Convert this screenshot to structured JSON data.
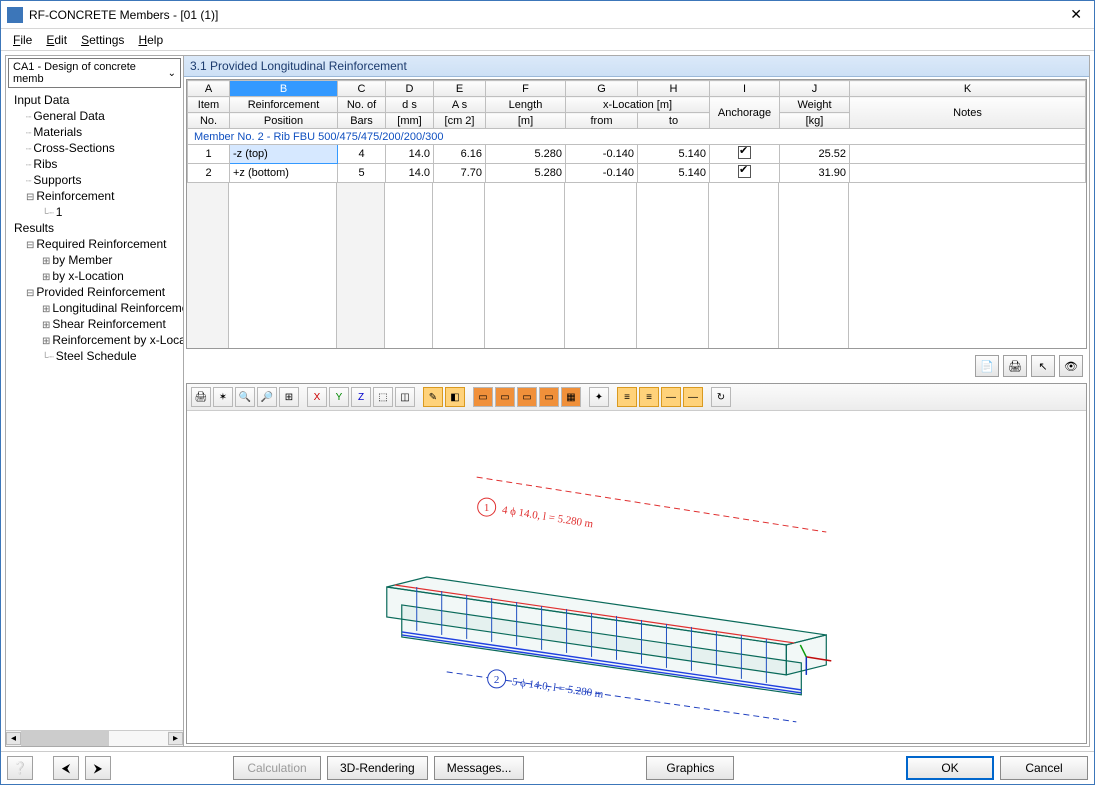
{
  "window": {
    "title": "RF-CONCRETE Members - [01 (1)]"
  },
  "menu": {
    "file": "File",
    "edit": "Edit",
    "settings": "Settings",
    "help": "Help"
  },
  "case_dropdown": "CA1 - Design of concrete memb",
  "tree": {
    "section_input": "Input Data",
    "general_data": "General Data",
    "materials": "Materials",
    "cross_sections": "Cross-Sections",
    "ribs": "Ribs",
    "supports": "Supports",
    "reinforcement": "Reinforcement",
    "reinf_1": "1",
    "section_results": "Results",
    "required": "Required Reinforcement",
    "by_member": "by Member",
    "by_x": "by x-Location",
    "provided": "Provided Reinforcement",
    "long_reinf": "Longitudinal Reinforcement",
    "shear_reinf": "Shear Reinforcement",
    "reinf_by_x": "Reinforcement by x-Location",
    "steel_sched": "Steel Schedule"
  },
  "panel_title": "3.1 Provided Longitudinal Reinforcement",
  "columns": {
    "letters": [
      "A",
      "B",
      "C",
      "D",
      "E",
      "F",
      "G",
      "H",
      "I",
      "J",
      "K"
    ],
    "h": {
      "item": "Item",
      "reinforcement": "Reinforcement",
      "no_of": "No. of",
      "ds": "d s",
      "as": "A s",
      "length": "Length",
      "xloc": "x-Location [m]",
      "anchorage": "Anchorage",
      "weight": "Weight",
      "notes": "Notes",
      "no": "No.",
      "position": "Position",
      "bars": "Bars",
      "mm": "[mm]",
      "cm2": "[cm 2]",
      "m": "[m]",
      "from": "from",
      "to": "to",
      "kg": "[kg]"
    }
  },
  "member_row": "Member No. 2  -  Rib FBU 500/475/475/200/200/300",
  "rows": [
    {
      "item": "1",
      "pos": "-z (top)",
      "bars": "4",
      "ds": "14.0",
      "as": "6.16",
      "len": "5.280",
      "from": "-0.140",
      "to": "5.140",
      "anchor": true,
      "weight": "25.52",
      "notes": ""
    },
    {
      "item": "2",
      "pos": "+z (bottom)",
      "bars": "5",
      "ds": "14.0",
      "as": "7.70",
      "len": "5.280",
      "from": "-0.140",
      "to": "5.140",
      "anchor": true,
      "weight": "31.90",
      "notes": ""
    }
  ],
  "diagram": {
    "top": {
      "num": "1",
      "label": "4 ϕ 14.0, l = 5.280 m"
    },
    "bot": {
      "num": "2",
      "label": "5 ϕ 14.0, l = 5.280 m"
    }
  },
  "buttons": {
    "calculation": "Calculation",
    "rendering": "3D-Rendering",
    "messages": "Messages...",
    "graphics": "Graphics",
    "ok": "OK",
    "cancel": "Cancel"
  }
}
